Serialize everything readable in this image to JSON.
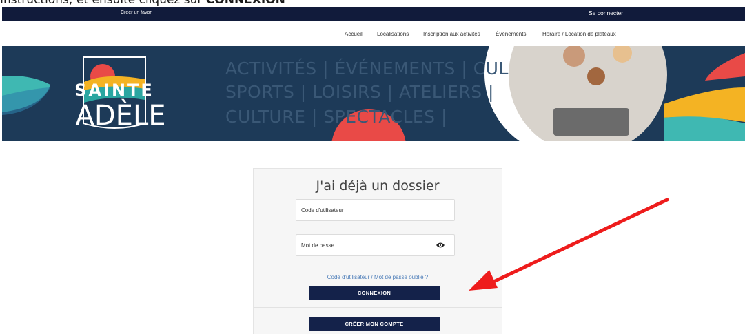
{
  "caption": {
    "text": "Instructions; et ensuite cliquez sur ",
    "bold": "CONNEXION"
  },
  "topbar": {
    "favorite": "Créer un favori",
    "login": "Se connecter"
  },
  "nav": {
    "items": [
      "Accueil",
      "Localisations",
      "Inscription aux activités",
      "Évènements",
      "Horaire / Location de plateaux"
    ]
  },
  "banner": {
    "logo_line1": "SAINTE",
    "logo_line2": "ADÈLE",
    "taglines": [
      "ACTIVITÉS | ÉVÉNEMENTS | CUL",
      "SPORTS | LOISIRS | ATELIERS | ",
      "CULTURE | SPECTACLES | "
    ]
  },
  "login": {
    "title": "J'ai déjà un dossier",
    "username_placeholder": "Code d'utilisateur",
    "password_placeholder": "Mot de passe",
    "forgot": "Code d'utilisateur / Mot de passe oublié ?",
    "connect_button": "CONNEXION",
    "create_button": "CRÉER MON COMPTE"
  },
  "colors": {
    "navy": "#14224a",
    "banner": "#1d3a58",
    "arrow": "#ee1c1c",
    "link": "#4b7cb8"
  }
}
